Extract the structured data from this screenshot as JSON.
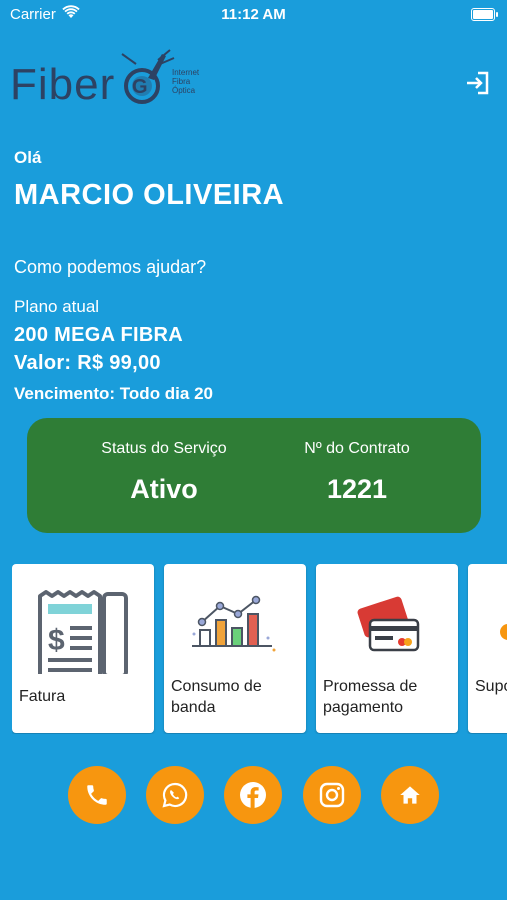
{
  "status_bar": {
    "carrier": "Carrier",
    "time": "11:12 AM"
  },
  "logo": {
    "word": "Fiber",
    "tagline": [
      "Internet",
      "Fibra",
      "Óptica"
    ]
  },
  "greeting": {
    "hello": "Olá",
    "name": "MARCIO OLIVEIRA",
    "help": "Como podemos ajudar?"
  },
  "plan": {
    "label": "Plano atual",
    "name": "200 MEGA FIBRA",
    "price": "Valor: R$ 99,00",
    "due": "Vencimento: Todo dia 20"
  },
  "service": {
    "status_label": "Status do Serviço",
    "status_value": "Ativo",
    "contract_label": "Nº do Contrato",
    "contract_value": "1221"
  },
  "menu": [
    {
      "label": "Fatura",
      "icon": "invoice-icon"
    },
    {
      "label": "Consumo de banda",
      "icon": "bar-chart-icon"
    },
    {
      "label": "Promessa de pagamento",
      "icon": "credit-card-icon"
    },
    {
      "label": "Suporte",
      "icon": "support-icon"
    }
  ],
  "socials": [
    "phone-icon",
    "whatsapp-icon",
    "facebook-icon",
    "instagram-icon",
    "home-icon"
  ],
  "colors": {
    "background": "#1a9ddb",
    "status_card": "#2f7d36",
    "accent": "#f7960f",
    "logo": "#2d4263"
  }
}
